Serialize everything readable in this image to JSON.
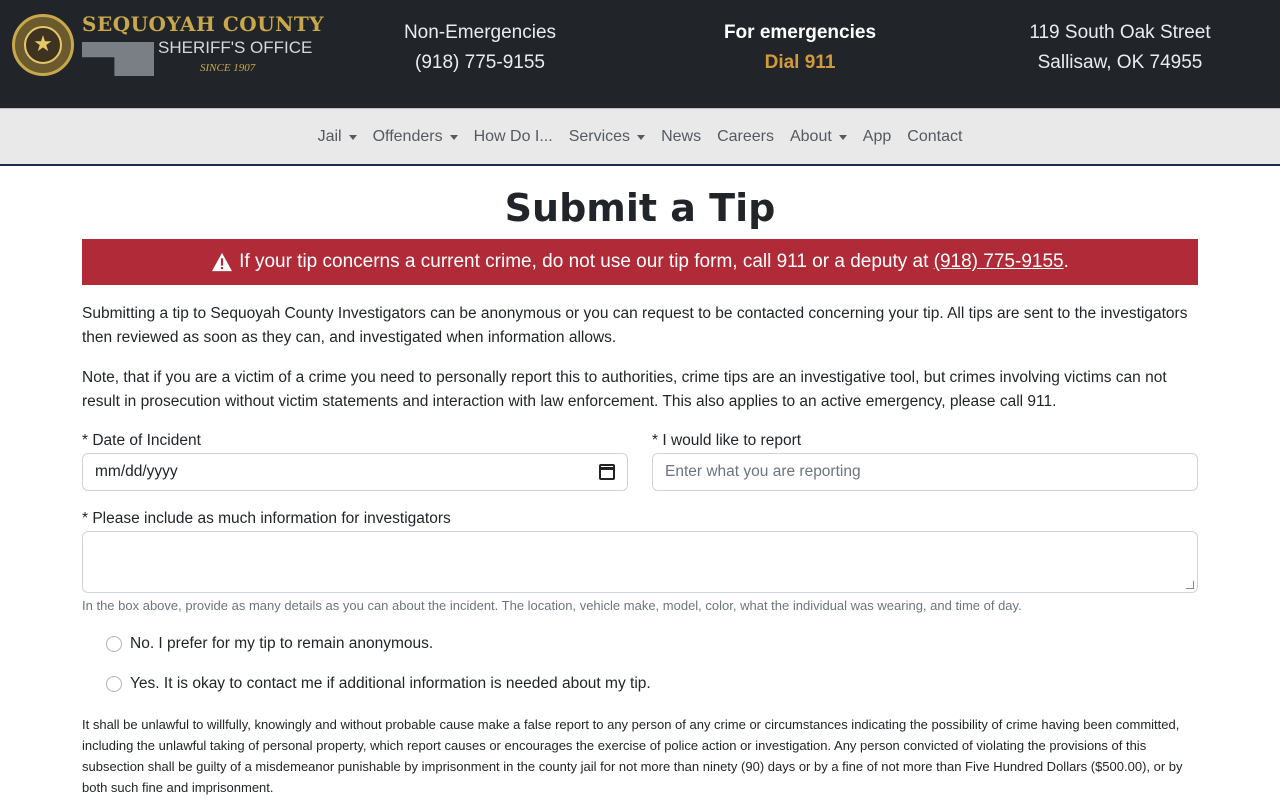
{
  "header": {
    "logo": {
      "title": "SEQUOYAH COUNTY",
      "subtitle": "SHERIFF'S OFFICE",
      "since": "SINCE 1907"
    },
    "non_emergency": {
      "label": "Non-Emergencies",
      "phone": "(918) 775-9155"
    },
    "emergency": {
      "label": "For emergencies",
      "value": "Dial 911"
    },
    "address": {
      "line1": "119 South Oak Street",
      "line2": "Sallisaw, OK 74955"
    }
  },
  "nav": {
    "items": [
      {
        "label": "Jail",
        "dropdown": true
      },
      {
        "label": "Offenders",
        "dropdown": true
      },
      {
        "label": "How Do I...",
        "dropdown": false
      },
      {
        "label": "Services",
        "dropdown": true
      },
      {
        "label": "News",
        "dropdown": false
      },
      {
        "label": "Careers",
        "dropdown": false
      },
      {
        "label": "About",
        "dropdown": true
      },
      {
        "label": "App",
        "dropdown": false
      },
      {
        "label": "Contact",
        "dropdown": false
      }
    ]
  },
  "page": {
    "title": "Submit a Tip",
    "alert": {
      "text": "If your tip concerns a current crime, do not use our tip form, call 911 or a deputy at",
      "phone": "(918) 775-9155",
      "end": "."
    },
    "intro": "Submitting a tip to Sequoyah County Investigators can be anonymous or you can request to be contacted concerning your tip. All tips are sent to the investigators then reviewed as soon as they can, and investigated when information allows.",
    "note": "Note, that if you are a victim of a crime you need to personally report this to authorities, crime tips are an investigative tool, but crimes involving victims can not result in prosecution without victim statements and interaction with law enforcement. This also applies to an active emergency, please call 911."
  },
  "form": {
    "date": {
      "label": "* Date of Incident",
      "value": "mm/dd/yyyy"
    },
    "report": {
      "label": "* I would like to report",
      "placeholder": "Enter what you are reporting"
    },
    "details": {
      "label": "* Please include as much information for investigators",
      "value": ""
    },
    "help": "In the box above, provide as many details as you can about the incident. The location, vehicle make, model, color, what the individual was wearing, and time of day.",
    "radios": [
      {
        "label": "No. I prefer for my tip to remain anonymous.",
        "checked": false
      },
      {
        "label": "Yes. It is okay to contact me if additional information is needed about my tip.",
        "checked": false
      }
    ],
    "legal": "It shall be unlawful to willfully, knowingly and without probable cause make a false report to any person of any crime or circumstances indicating the possibility of crime having been committed, including the unlawful taking of personal property, which report causes or encourages the exercise of police action or investigation. Any person convicted of violating the provisions of this subsection shall be guilty of a misdemeanor punishable by imprisonment in the county jail for not more than ninety (90) days or by a fine of not more than Five Hundred Dollars ($500.00), or by both such fine and imprisonment."
  },
  "colors": {
    "header_bg": "#212529",
    "nav_bg": "#e9e9e9",
    "alert_bg": "#b02a37",
    "emergency_accent": "#d39a3c",
    "logo_gold": "#c9a84c"
  }
}
